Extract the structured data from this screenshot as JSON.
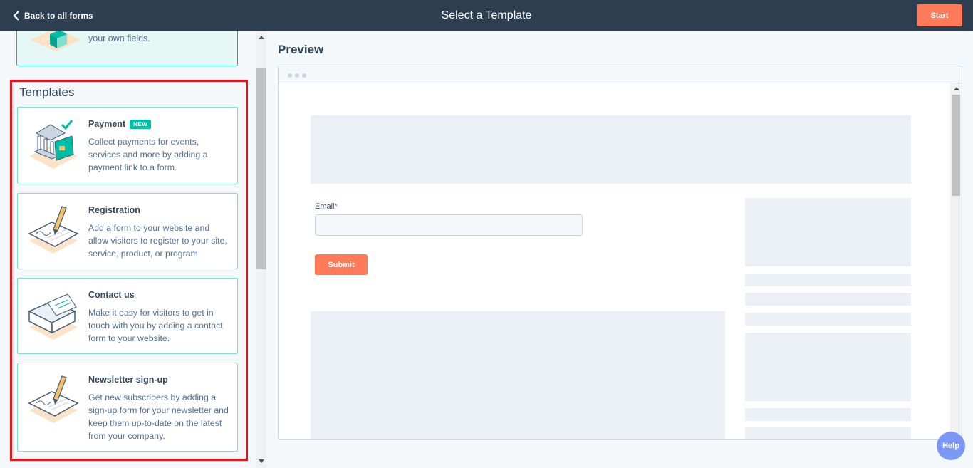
{
  "header": {
    "back_label": "Back to all forms",
    "title": "Select a Template",
    "start_label": "Start"
  },
  "left_panel": {
    "top_card_text": "your own fields.",
    "templates_heading": "Templates",
    "templates": [
      {
        "title": "Payment",
        "badge": "NEW",
        "description": "Collect payments for events, services and more by adding a payment link to a form.",
        "icon": "bank-card-icon"
      },
      {
        "title": "Registration",
        "description": "Add a form to your website and allow visitors to register to your site, service, product, or program.",
        "icon": "pencil-signature-icon"
      },
      {
        "title": "Contact us",
        "description": "Make it easy for visitors to get in touch with you by adding a contact form to your website.",
        "icon": "envelope-icon"
      },
      {
        "title": "Newsletter sign-up",
        "description": "Get new subscribers by adding a sign-up form for your newsletter and keep them up-to-date on the latest from your company.",
        "icon": "pencil-signature-icon"
      }
    ]
  },
  "preview": {
    "heading": "Preview",
    "email_label": "Email",
    "required_mark": "*",
    "submit_label": "Submit"
  },
  "help_label": "Help",
  "colors": {
    "topbar": "#2d3e50",
    "accent": "#ff7a59",
    "teal": "#00bda5",
    "highlight_box": "#e8121a",
    "help": "#7c98f6"
  }
}
